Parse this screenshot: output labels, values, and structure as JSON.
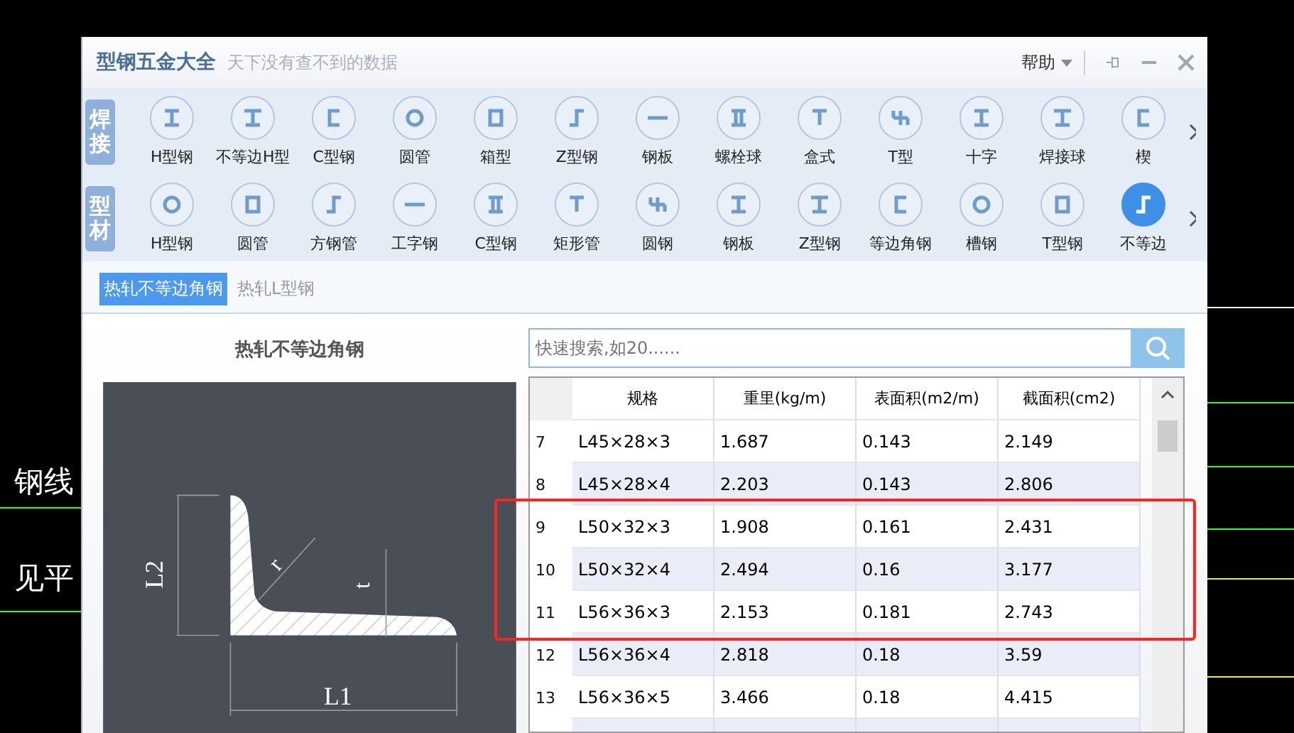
{
  "background": {
    "texts": [
      "钢线",
      "见平"
    ]
  },
  "window": {
    "title": "型钢五金大全",
    "subtitle": "天下没有查不到的数据",
    "help": "帮助"
  },
  "categories": [
    {
      "label": "焊接",
      "items": [
        {
          "label": "H型钢",
          "selected": false
        },
        {
          "label": "不等边H型",
          "selected": false
        },
        {
          "label": "C型钢",
          "selected": false
        },
        {
          "label": "圆管",
          "selected": false
        },
        {
          "label": "箱型",
          "selected": false
        },
        {
          "label": "Z型钢",
          "selected": false
        },
        {
          "label": "钢板",
          "selected": false
        },
        {
          "label": "螺栓球",
          "selected": false
        },
        {
          "label": "盒式",
          "selected": false
        },
        {
          "label": "T型",
          "selected": false
        },
        {
          "label": "十字",
          "selected": false
        },
        {
          "label": "焊接球",
          "selected": false
        },
        {
          "label": "楔",
          "selected": false
        }
      ]
    },
    {
      "label": "型材",
      "items": [
        {
          "label": "H型钢",
          "selected": false
        },
        {
          "label": "圆管",
          "selected": false
        },
        {
          "label": "方钢管",
          "selected": false
        },
        {
          "label": "工字钢",
          "selected": false
        },
        {
          "label": "C型钢",
          "selected": false
        },
        {
          "label": "矩形管",
          "selected": false
        },
        {
          "label": "圆钢",
          "selected": false
        },
        {
          "label": "钢板",
          "selected": false
        },
        {
          "label": "Z型钢",
          "selected": false
        },
        {
          "label": "等边角钢",
          "selected": false
        },
        {
          "label": "槽钢",
          "selected": false
        },
        {
          "label": "T型钢",
          "selected": false
        },
        {
          "label": "不等边",
          "selected": true
        }
      ]
    }
  ],
  "subtabs": [
    {
      "label": "热轧不等边角钢",
      "selected": true
    },
    {
      "label": "热轧L型钢",
      "selected": false
    }
  ],
  "diagram": {
    "title": "热轧不等边角钢",
    "labels": [
      "L2",
      "r",
      "t",
      "L1"
    ]
  },
  "search": {
    "placeholder": "快速搜索,如20......"
  },
  "table": {
    "columns": [
      "规格",
      "重里(kg/m)",
      "表面积(m2/m)",
      "截面积(cm2)"
    ],
    "rows": [
      {
        "index": "7",
        "cells": [
          "L45×28×3",
          "1.687",
          "0.143",
          "2.149"
        ]
      },
      {
        "index": "8",
        "cells": [
          "L45×28×4",
          "2.203",
          "0.143",
          "2.806"
        ]
      },
      {
        "index": "9",
        "cells": [
          "L50×32×3",
          "1.908",
          "0.161",
          "2.431"
        ]
      },
      {
        "index": "10",
        "cells": [
          "L50×32×4",
          "2.494",
          "0.16",
          "3.177"
        ]
      },
      {
        "index": "11",
        "cells": [
          "L56×36×3",
          "2.153",
          "0.181",
          "2.743"
        ]
      },
      {
        "index": "12",
        "cells": [
          "L56×36×4",
          "2.818",
          "0.18",
          "3.59"
        ]
      },
      {
        "index": "13",
        "cells": [
          "L56×36×5",
          "3.466",
          "0.18",
          "4.415"
        ]
      }
    ]
  }
}
